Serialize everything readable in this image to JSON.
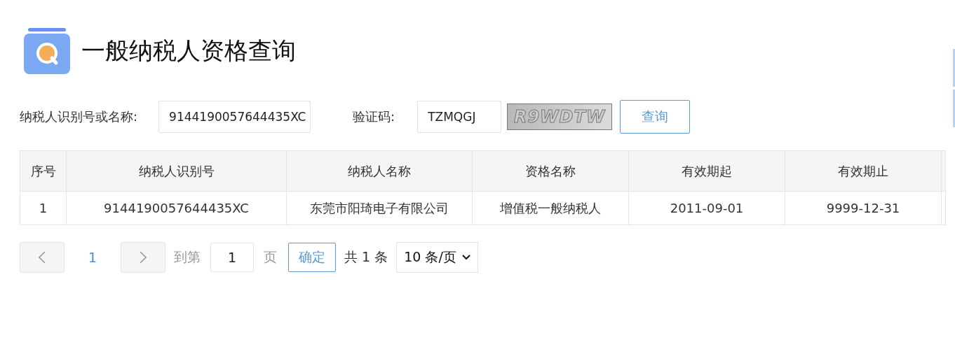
{
  "header": {
    "title": "一般纳税人资格查询"
  },
  "form": {
    "id_label": "纳税人识别号或名称:",
    "id_value": "9144190057644435XC",
    "captcha_label": "验证码:",
    "captcha_value": "TZMQGJ",
    "captcha_image_text": "R9WDTW",
    "search_button": "查询"
  },
  "table": {
    "columns": [
      "序号",
      "纳税人识别号",
      "纳税人名称",
      "资格名称",
      "有效期起",
      "有效期止"
    ],
    "rows": [
      [
        "1",
        "9144190057644435XC",
        "东莞市阳琦电子有限公司",
        "增值税一般纳税人",
        "2011-09-01",
        "9999-12-31"
      ]
    ]
  },
  "pagination": {
    "pages": [
      {
        "label": "1",
        "selected": true
      }
    ],
    "goto_label": "到第",
    "goto_value": "1",
    "page_unit": "页",
    "confirm": "确定",
    "total": "共 1 条",
    "page_size": "10 条/页"
  }
}
